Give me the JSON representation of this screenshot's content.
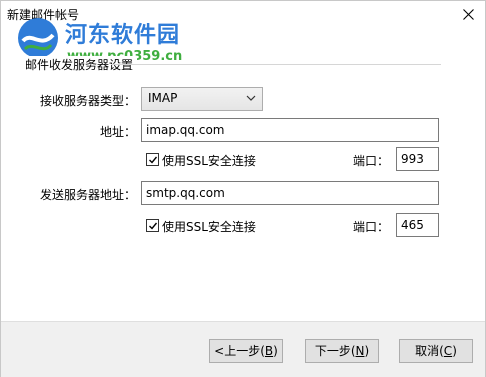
{
  "window": {
    "title": "新建邮件帐号"
  },
  "watermark": {
    "site_name": "河东软件园",
    "site_url": "www.pc0359.cn"
  },
  "group": {
    "title": "邮件收发服务器设置"
  },
  "incoming": {
    "type_label": "接收服务器类型：",
    "type_value": "IMAP",
    "address_label": "地址：",
    "address_value": "imap.qq.com",
    "ssl_label": "使用SSL安全连接",
    "ssl_checked": true,
    "port_label": "端口：",
    "port_value": "993"
  },
  "outgoing": {
    "address_label": "发送服务器地址：",
    "address_value": "smtp.qq.com",
    "ssl_label": "使用SSL安全连接",
    "ssl_checked": true,
    "port_label": "端口：",
    "port_value": "465"
  },
  "buttons": {
    "back_label": "<上一步(",
    "back_key": "B",
    "next_label": "下一步(",
    "next_key": "N",
    "cancel_label": "取消(",
    "cancel_key": "C",
    "close_paren": ")"
  },
  "icons": {
    "close": "close-icon",
    "dropdown": "chevron-down-icon",
    "check": "check-icon",
    "logo": "river-logo-icon"
  },
  "colors": {
    "watermark_blue": "#2f7cd8",
    "watermark_green": "#3fae3f",
    "footer_bg": "#f0f0f0"
  }
}
